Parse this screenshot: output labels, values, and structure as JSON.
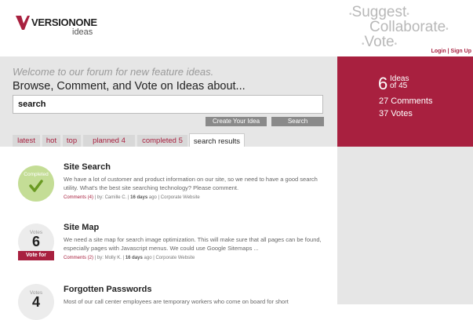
{
  "brand": {
    "name": "VERSIONONE",
    "sub": "ideas",
    "accent": "#a8203f"
  },
  "tagline": [
    "Suggest",
    "Collaborate",
    "Vote"
  ],
  "auth": {
    "login": "Login",
    "sep": "|",
    "signup": "Sign Up"
  },
  "hero": {
    "welcome": "Welcome to our forum for new feature ideas.",
    "browse": "Browse, Comment, and Vote on Ideas about...",
    "search_value": "search",
    "create_label": "Create Your Idea",
    "search_label": "Search"
  },
  "tabs": [
    {
      "label": "latest",
      "count": ""
    },
    {
      "label": "hot",
      "count": ""
    },
    {
      "label": "top",
      "count": ""
    },
    {
      "label": "planned",
      "count": "4"
    },
    {
      "label": "completed",
      "count": "5"
    },
    {
      "label": "search results",
      "count": "",
      "active": true
    }
  ],
  "stats": {
    "ideas_count": "6",
    "ideas_label": "Ideas",
    "ideas_of": "of 45",
    "comments": "27 Comments",
    "votes": "37 Votes"
  },
  "ideas": [
    {
      "status": "Completed",
      "title": "Site Search",
      "description": "We have a lot of customer and product information on our site, so we need to have a good search utility. What's the best site searching technology? Please comment.",
      "comments": "Comments (4)",
      "by": "by: Camille C.",
      "age": "16 days",
      "age_suffix": "ago",
      "category": "Corporate Website"
    },
    {
      "status": "Votes",
      "votes": "6",
      "vote_for": "Vote for",
      "title": "Site Map",
      "description": "We need a site map for search image optimization. This will make sure that all pages can be found, especially pages with Javascript menus. We could use Google Sitemaps ...",
      "comments": "Comments (2)",
      "by": "by: Molly K.",
      "age": "16 days",
      "age_suffix": "ago",
      "category": "Corporate Website"
    },
    {
      "status": "Votes",
      "votes": "4",
      "title": "Forgotten Passwords",
      "description": "Most of our call center employees are temporary workers who come on board for short"
    }
  ]
}
